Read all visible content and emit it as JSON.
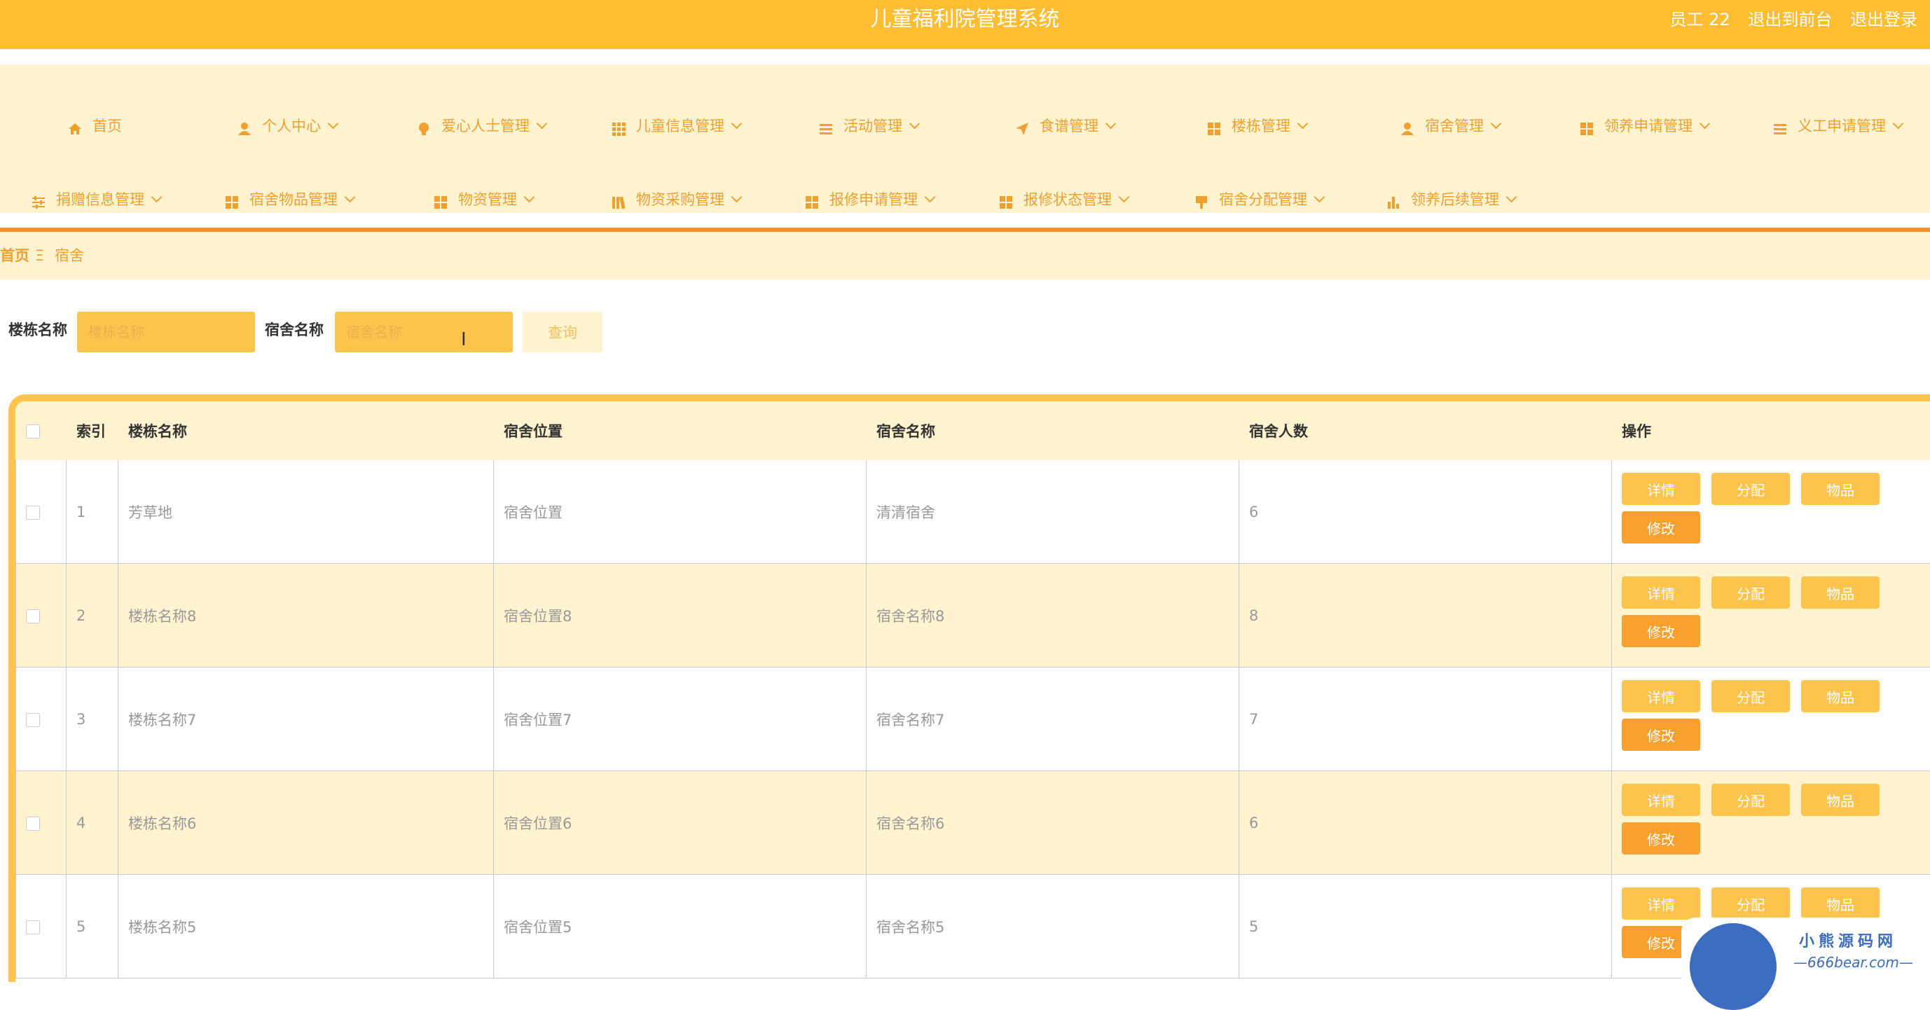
{
  "header": {
    "title": "儿童福利院管理系统",
    "user": "员工 22",
    "front_link": "退出到前台",
    "logout_link": "退出登录"
  },
  "nav": {
    "row1": [
      {
        "label": "首页",
        "icon": "home-icon"
      },
      {
        "label": "个人中心",
        "icon": "user-icon"
      },
      {
        "label": "爱心人士管理",
        "icon": "bulb-icon"
      },
      {
        "label": "儿童信息管理",
        "icon": "grid-icon"
      },
      {
        "label": "活动管理",
        "icon": "list-icon"
      },
      {
        "label": "食谱管理",
        "icon": "send-icon"
      },
      {
        "label": "楼栋管理",
        "icon": "apps-icon"
      },
      {
        "label": "宿舍管理",
        "icon": "user-icon"
      },
      {
        "label": "领养申请管理",
        "icon": "apps-icon"
      },
      {
        "label": "义工申请管理",
        "icon": "list-icon"
      }
    ],
    "row2": [
      {
        "label": "捐赠信息管理",
        "icon": "sliders-icon"
      },
      {
        "label": "宿舍物品管理",
        "icon": "apps-icon"
      },
      {
        "label": "物资管理",
        "icon": "apps-icon"
      },
      {
        "label": "物资采购管理",
        "icon": "library-icon"
      },
      {
        "label": "报修申请管理",
        "icon": "apps-icon"
      },
      {
        "label": "报修状态管理",
        "icon": "apps-icon"
      },
      {
        "label": "宿舍分配管理",
        "icon": "brush-icon"
      },
      {
        "label": "领养后续管理",
        "icon": "bar-chart-icon"
      }
    ]
  },
  "breadcrumb": {
    "home": "首页",
    "separator": "Ξ",
    "current": "宿舍"
  },
  "search": {
    "building_label": "楼栋名称",
    "building_placeholder": "楼栋名称",
    "dorm_label": "宿舍名称",
    "dorm_placeholder": "宿舍名称",
    "query_button": "查询"
  },
  "table": {
    "headers": [
      "索引",
      "楼栋名称",
      "宿舍位置",
      "宿舍名称",
      "宿舍人数",
      "操作"
    ],
    "rows": [
      {
        "index": "1",
        "building": "芳草地",
        "location": "宿舍位置",
        "name": "清清宿舍",
        "count": "6"
      },
      {
        "index": "2",
        "building": "楼栋名称8",
        "location": "宿舍位置8",
        "name": "宿舍名称8",
        "count": "8"
      },
      {
        "index": "3",
        "building": "楼栋名称7",
        "location": "宿舍位置7",
        "name": "宿舍名称7",
        "count": "7"
      },
      {
        "index": "4",
        "building": "楼栋名称6",
        "location": "宿舍位置6",
        "name": "宿舍名称6",
        "count": "6"
      },
      {
        "index": "5",
        "building": "楼栋名称5",
        "location": "宿舍位置5",
        "name": "宿舍名称5",
        "count": "5"
      }
    ],
    "actions": {
      "detail": "详情",
      "assign": "分配",
      "items": "物品",
      "edit": "修改"
    }
  },
  "watermark": {
    "line1": "小熊源码网",
    "line2": "—666bear.com—"
  },
  "colors": {
    "primary": "#FFBD33",
    "light": "#FFF3D0",
    "accent": "#F5902A",
    "button": "#FFC44D",
    "edit_button": "#F8A030"
  }
}
